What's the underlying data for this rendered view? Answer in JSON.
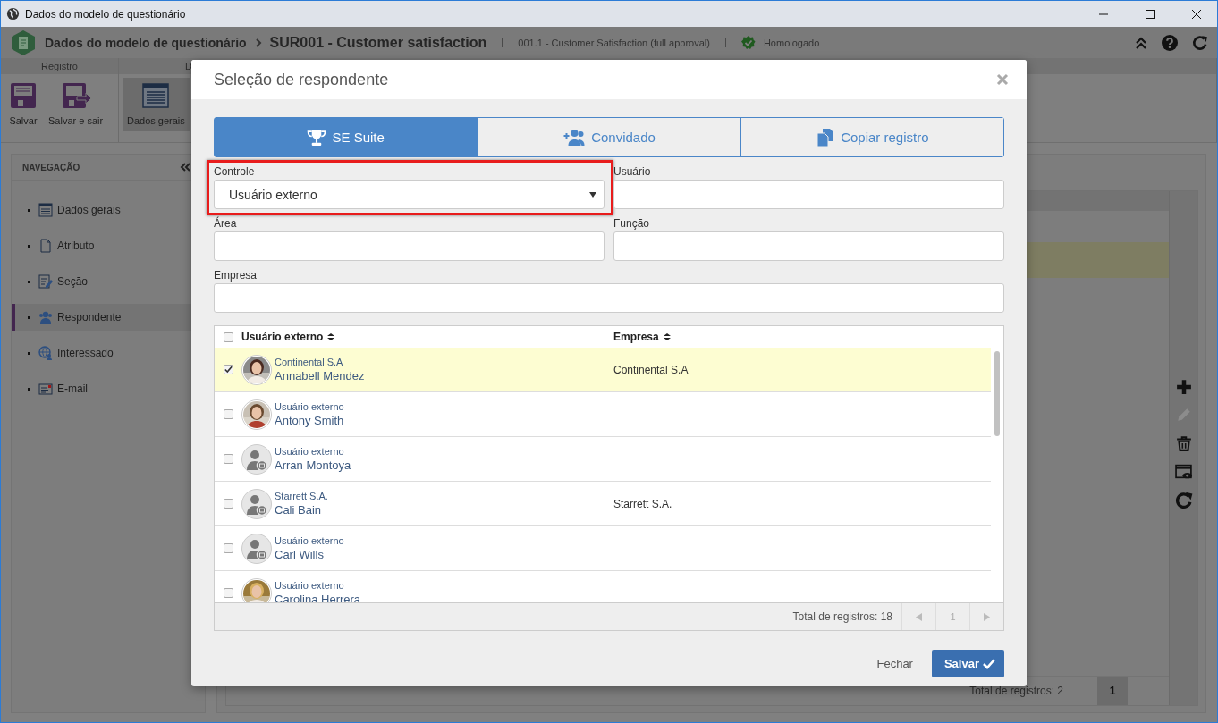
{
  "window": {
    "title": "Dados do modelo de questionário"
  },
  "header": {
    "breadcrumb": "Dados do modelo de questionário",
    "record": "SUR001 - Customer satisfaction",
    "revision": "001.1 - Customer Satisfaction (full approval)",
    "status": "Homologado"
  },
  "ribbon": {
    "groups": [
      "Registro",
      "D"
    ],
    "buttons": [
      {
        "label": "Salvar",
        "kind": "save",
        "selected": false
      },
      {
        "label": "Salvar e sair",
        "kind": "save-exit",
        "selected": false
      },
      {
        "label": "Dados gerais",
        "kind": "form",
        "selected": true
      }
    ]
  },
  "navigation": {
    "title": "NAVEGAÇÃO",
    "items": [
      {
        "label": "Dados gerais",
        "kind": "form",
        "selected": false
      },
      {
        "label": "Atributo",
        "kind": "document",
        "selected": false
      },
      {
        "label": "Seção",
        "kind": "edit",
        "selected": false
      },
      {
        "label": "Respondente",
        "kind": "users",
        "selected": true
      },
      {
        "label": "Interessado",
        "kind": "globe",
        "selected": false
      },
      {
        "label": "E-mail",
        "kind": "email",
        "selected": false
      }
    ]
  },
  "content": {
    "total": "Total de registros: 2",
    "page": "1"
  },
  "dialog": {
    "title": "Seleção de respondente",
    "tabs": [
      {
        "label": "SE Suite",
        "kind": "trophy",
        "selected": true
      },
      {
        "label": "Convidado",
        "kind": "add-user",
        "selected": false
      },
      {
        "label": "Copiar registro",
        "kind": "copy",
        "selected": false
      }
    ],
    "field_rows": [
      [
        {
          "label": "Controle",
          "kind": "select",
          "value": "Usuário externo",
          "highlighted": true
        },
        {
          "label": "Usuário",
          "kind": "text",
          "highlighted": false
        }
      ],
      [
        {
          "label": "Área",
          "kind": "text",
          "highlighted": false
        },
        {
          "label": "Função",
          "kind": "text",
          "highlighted": false
        }
      ],
      [
        {
          "label": "Empresa",
          "kind": "text",
          "highlighted": false
        }
      ]
    ],
    "table": {
      "columns": [
        "Usuário externo",
        "Empresa"
      ],
      "all_checked": false,
      "rows": [
        {
          "checked": true,
          "selected": true,
          "subtitle": "Continental S.A",
          "name": "Annabell Mendez",
          "company": "Continental S.A"
        },
        {
          "checked": false,
          "selected": false,
          "subtitle": "Usuário externo",
          "name": "Antony Smith"
        },
        {
          "checked": false,
          "selected": false,
          "kind": "placeholder",
          "subtitle": "Usuário externo",
          "name": "Arran Montoya"
        },
        {
          "checked": false,
          "selected": false,
          "kind": "placeholder",
          "subtitle": "Starrett S.A.",
          "name": "Cali Bain",
          "company": "Starrett S.A."
        },
        {
          "checked": false,
          "selected": false,
          "kind": "placeholder",
          "subtitle": "Usuário externo",
          "name": "Carl Wills"
        },
        {
          "checked": false,
          "selected": false,
          "subtitle": "Usuário externo",
          "name": "Carolina Herrera"
        }
      ],
      "total": "Total de registros: 18",
      "page": "1"
    },
    "buttons": [
      {
        "label": "Fechar",
        "kind": "link"
      },
      {
        "label": "Salvar",
        "kind": "primary"
      }
    ]
  }
}
